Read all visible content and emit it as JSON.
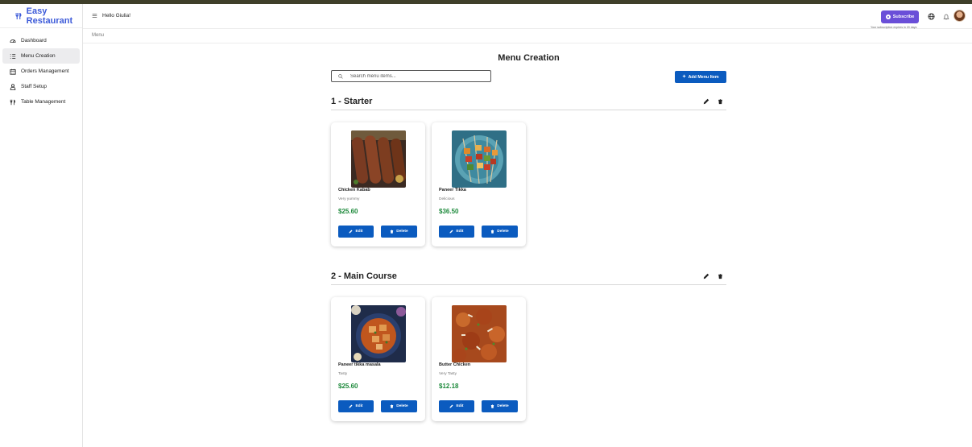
{
  "app": {
    "name": "Easy Restaurant"
  },
  "sidebar": {
    "items": [
      {
        "label": "Dashboard",
        "icon": "dashboard-icon"
      },
      {
        "label": "Menu Creation",
        "icon": "list-icon",
        "active": true
      },
      {
        "label": "Orders Management",
        "icon": "calendar-icon"
      },
      {
        "label": "Staff Setup",
        "icon": "person-icon"
      },
      {
        "label": "Table Management",
        "icon": "restaurant-icon"
      }
    ]
  },
  "header": {
    "greeting": "Hello Giulia!",
    "subscribe_label": "Subscribe",
    "subscription_note": "Your subscription expires in 20 days"
  },
  "breadcrumb": "Menu",
  "main": {
    "title": "Menu Creation",
    "search_placeholder": "Search menu items...",
    "add_label": "Add Menu Item"
  },
  "sections": [
    {
      "title": "1 - Starter",
      "items": [
        {
          "name": "Chicken Kabab",
          "description": "Very yummy",
          "price": "$25.60",
          "edit": "Edit",
          "delete": "Delete"
        },
        {
          "name": "Paneer Tikka",
          "description": "Delicious",
          "price": "$36.50",
          "edit": "Edit",
          "delete": "Delete"
        }
      ]
    },
    {
      "title": "2 - Main Course",
      "items": [
        {
          "name": "Paneer tikka masala",
          "description": "Tasty",
          "price": "$25.60",
          "edit": "Edit",
          "delete": "Delete"
        },
        {
          "name": "Butter Chicken",
          "description": "Very Tasty",
          "price": "$12.18",
          "edit": "Edit",
          "delete": "Delete"
        }
      ]
    }
  ],
  "colors": {
    "brand": "#3d5bd9",
    "primary_button": "#0b5bbf",
    "price": "#1e8a3c",
    "subscribe": "#6a4fd8"
  }
}
